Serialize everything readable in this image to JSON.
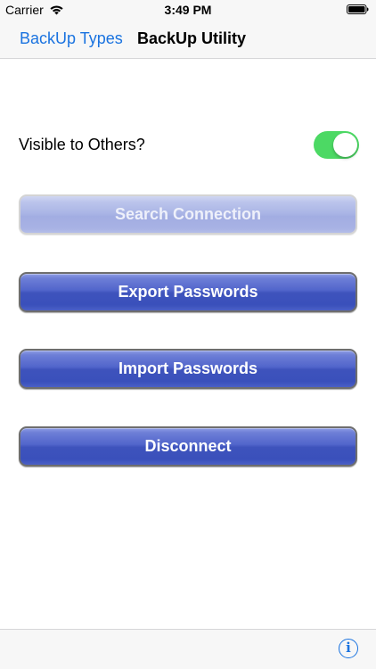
{
  "status_bar": {
    "carrier": "Carrier",
    "time": "3:49 PM",
    "wifi_icon": "wifi-icon",
    "battery_icon": "battery-icon"
  },
  "nav": {
    "back_label": "BackUp Types",
    "title": "BackUp Utility"
  },
  "settings": {
    "visible_label": "Visible to Others?",
    "visible_on": true,
    "switch_color": "#4cd964"
  },
  "buttons": {
    "search": {
      "label": "Search Connection",
      "enabled": false
    },
    "export": {
      "label": "Export Passwords",
      "enabled": true
    },
    "import": {
      "label": "Import Passwords",
      "enabled": true
    },
    "disconnect": {
      "label": "Disconnect",
      "enabled": true
    }
  },
  "toolbar": {
    "info_icon": "info-icon",
    "info_glyph": "i"
  },
  "colors": {
    "accent": "#1a73e0",
    "button_blue": "#3e53bc"
  }
}
